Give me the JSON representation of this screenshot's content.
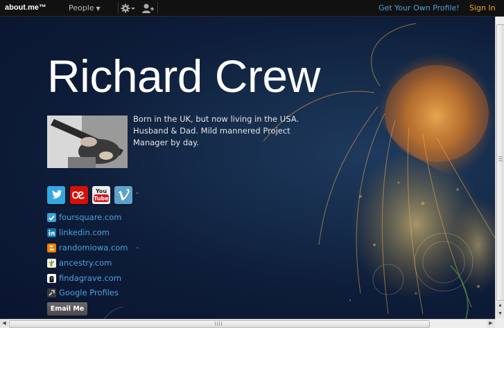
{
  "topbar": {
    "brand_prefix": "about",
    "brand_dot": ".",
    "brand_suffix": "me™",
    "people_label": "People",
    "get_profile_label": "Get Your Own Profile!",
    "signin_label": "Sign In"
  },
  "profile": {
    "name": "Richard Crew",
    "bio": "Born in the UK, but now living in the USA.  Husband & Dad.  Mild mannered Project Manager by day.",
    "email_button": "Email Me"
  },
  "social_icons": [
    "twitter-icon",
    "lastfm-icon",
    "youtube-icon",
    "vimeo-icon"
  ],
  "youtube_text": {
    "top": "You",
    "bottom": "Tube"
  },
  "links": [
    {
      "label": "foursquare.com",
      "icon": "foursquare-icon"
    },
    {
      "label": "linkedin.com",
      "icon": "linkedin-icon"
    },
    {
      "label": "randomiowa.com",
      "icon": "blogger-icon"
    },
    {
      "label": "ancestry.com",
      "icon": "ancestry-icon"
    },
    {
      "label": "findagrave.com",
      "icon": "findagrave-icon"
    },
    {
      "label": "Google Profiles",
      "icon": "google-profiles-icon"
    }
  ],
  "colors": {
    "accent": "#f5a623",
    "link": "#4aa3df",
    "background": "#0d1c38"
  }
}
